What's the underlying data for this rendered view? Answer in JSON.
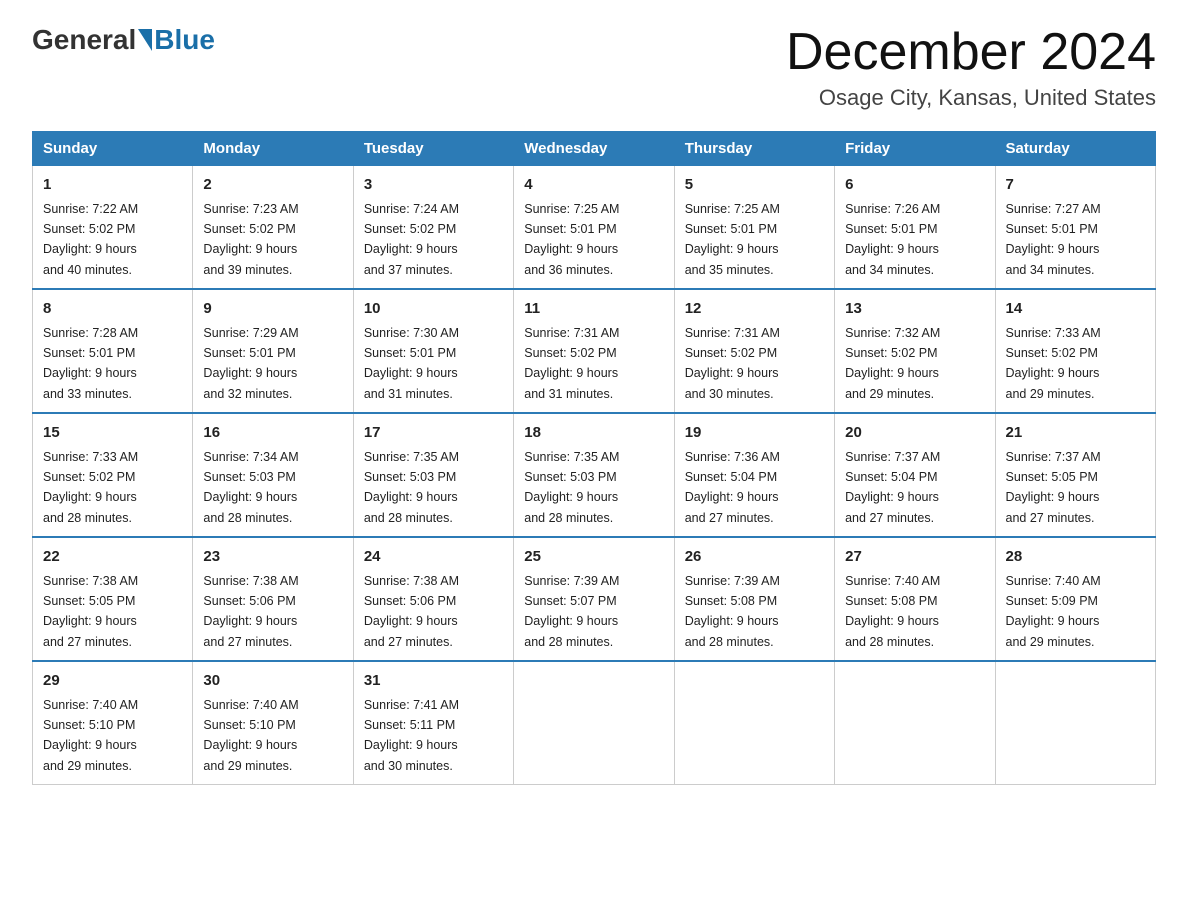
{
  "header": {
    "logo": {
      "text1": "General",
      "text2": "Blue"
    },
    "title": "December 2024",
    "subtitle": "Osage City, Kansas, United States"
  },
  "days_of_week": [
    "Sunday",
    "Monday",
    "Tuesday",
    "Wednesday",
    "Thursday",
    "Friday",
    "Saturday"
  ],
  "weeks": [
    [
      {
        "day": "1",
        "sunrise": "7:22 AM",
        "sunset": "5:02 PM",
        "daylight": "9 hours and 40 minutes."
      },
      {
        "day": "2",
        "sunrise": "7:23 AM",
        "sunset": "5:02 PM",
        "daylight": "9 hours and 39 minutes."
      },
      {
        "day": "3",
        "sunrise": "7:24 AM",
        "sunset": "5:02 PM",
        "daylight": "9 hours and 37 minutes."
      },
      {
        "day": "4",
        "sunrise": "7:25 AM",
        "sunset": "5:01 PM",
        "daylight": "9 hours and 36 minutes."
      },
      {
        "day": "5",
        "sunrise": "7:25 AM",
        "sunset": "5:01 PM",
        "daylight": "9 hours and 35 minutes."
      },
      {
        "day": "6",
        "sunrise": "7:26 AM",
        "sunset": "5:01 PM",
        "daylight": "9 hours and 34 minutes."
      },
      {
        "day": "7",
        "sunrise": "7:27 AM",
        "sunset": "5:01 PM",
        "daylight": "9 hours and 34 minutes."
      }
    ],
    [
      {
        "day": "8",
        "sunrise": "7:28 AM",
        "sunset": "5:01 PM",
        "daylight": "9 hours and 33 minutes."
      },
      {
        "day": "9",
        "sunrise": "7:29 AM",
        "sunset": "5:01 PM",
        "daylight": "9 hours and 32 minutes."
      },
      {
        "day": "10",
        "sunrise": "7:30 AM",
        "sunset": "5:01 PM",
        "daylight": "9 hours and 31 minutes."
      },
      {
        "day": "11",
        "sunrise": "7:31 AM",
        "sunset": "5:02 PM",
        "daylight": "9 hours and 31 minutes."
      },
      {
        "day": "12",
        "sunrise": "7:31 AM",
        "sunset": "5:02 PM",
        "daylight": "9 hours and 30 minutes."
      },
      {
        "day": "13",
        "sunrise": "7:32 AM",
        "sunset": "5:02 PM",
        "daylight": "9 hours and 29 minutes."
      },
      {
        "day": "14",
        "sunrise": "7:33 AM",
        "sunset": "5:02 PM",
        "daylight": "9 hours and 29 minutes."
      }
    ],
    [
      {
        "day": "15",
        "sunrise": "7:33 AM",
        "sunset": "5:02 PM",
        "daylight": "9 hours and 28 minutes."
      },
      {
        "day": "16",
        "sunrise": "7:34 AM",
        "sunset": "5:03 PM",
        "daylight": "9 hours and 28 minutes."
      },
      {
        "day": "17",
        "sunrise": "7:35 AM",
        "sunset": "5:03 PM",
        "daylight": "9 hours and 28 minutes."
      },
      {
        "day": "18",
        "sunrise": "7:35 AM",
        "sunset": "5:03 PM",
        "daylight": "9 hours and 28 minutes."
      },
      {
        "day": "19",
        "sunrise": "7:36 AM",
        "sunset": "5:04 PM",
        "daylight": "9 hours and 27 minutes."
      },
      {
        "day": "20",
        "sunrise": "7:37 AM",
        "sunset": "5:04 PM",
        "daylight": "9 hours and 27 minutes."
      },
      {
        "day": "21",
        "sunrise": "7:37 AM",
        "sunset": "5:05 PM",
        "daylight": "9 hours and 27 minutes."
      }
    ],
    [
      {
        "day": "22",
        "sunrise": "7:38 AM",
        "sunset": "5:05 PM",
        "daylight": "9 hours and 27 minutes."
      },
      {
        "day": "23",
        "sunrise": "7:38 AM",
        "sunset": "5:06 PM",
        "daylight": "9 hours and 27 minutes."
      },
      {
        "day": "24",
        "sunrise": "7:38 AM",
        "sunset": "5:06 PM",
        "daylight": "9 hours and 27 minutes."
      },
      {
        "day": "25",
        "sunrise": "7:39 AM",
        "sunset": "5:07 PM",
        "daylight": "9 hours and 28 minutes."
      },
      {
        "day": "26",
        "sunrise": "7:39 AM",
        "sunset": "5:08 PM",
        "daylight": "9 hours and 28 minutes."
      },
      {
        "day": "27",
        "sunrise": "7:40 AM",
        "sunset": "5:08 PM",
        "daylight": "9 hours and 28 minutes."
      },
      {
        "day": "28",
        "sunrise": "7:40 AM",
        "sunset": "5:09 PM",
        "daylight": "9 hours and 29 minutes."
      }
    ],
    [
      {
        "day": "29",
        "sunrise": "7:40 AM",
        "sunset": "5:10 PM",
        "daylight": "9 hours and 29 minutes."
      },
      {
        "day": "30",
        "sunrise": "7:40 AM",
        "sunset": "5:10 PM",
        "daylight": "9 hours and 29 minutes."
      },
      {
        "day": "31",
        "sunrise": "7:41 AM",
        "sunset": "5:11 PM",
        "daylight": "9 hours and 30 minutes."
      },
      null,
      null,
      null,
      null
    ]
  ],
  "labels": {
    "sunrise": "Sunrise:",
    "sunset": "Sunset:",
    "daylight": "Daylight:"
  }
}
